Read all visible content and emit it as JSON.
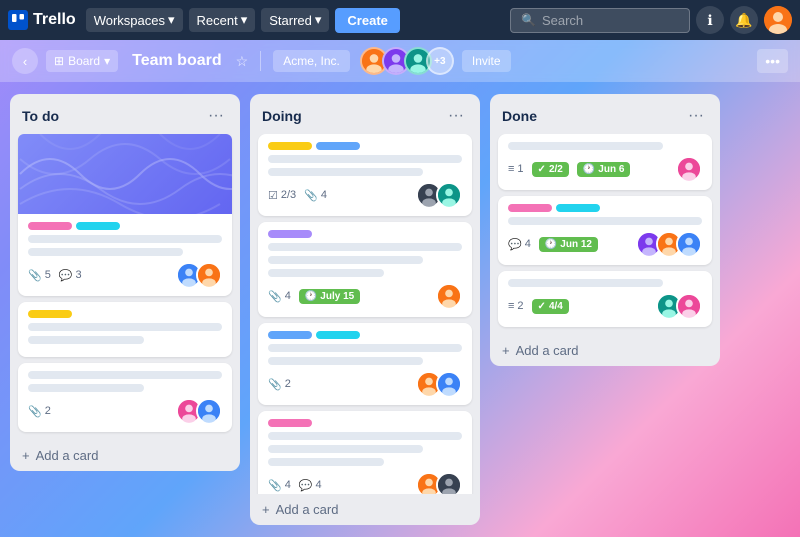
{
  "app": {
    "name": "Trello"
  },
  "topnav": {
    "workspaces_label": "Workspaces",
    "recent_label": "Recent",
    "starred_label": "Starred",
    "create_label": "Create",
    "search_placeholder": "Search",
    "chevron": "▾"
  },
  "board_header": {
    "view_label": "Board",
    "title": "Team board",
    "workspace_label": "Acme, Inc.",
    "more_members_label": "+3",
    "invite_label": "Invite",
    "more_label": "•••"
  },
  "columns": [
    {
      "id": "todo",
      "title": "To do",
      "cards": [
        {
          "id": "c1",
          "has_cover": true,
          "labels": [
            "pink",
            "cyan"
          ],
          "meta": {
            "attachments": "5",
            "comments": "3"
          },
          "avatars": [
            "orange",
            "blue"
          ]
        },
        {
          "id": "c2",
          "labels": [
            "yellow"
          ],
          "lines": [
            "full",
            "medium"
          ],
          "meta": {},
          "avatars": []
        },
        {
          "id": "c3",
          "labels": [],
          "lines": [
            "full",
            "short"
          ],
          "meta": {
            "attachments": "2"
          },
          "avatars": [
            "pink",
            "blue"
          ]
        }
      ],
      "add_card_label": "+ Add a card"
    },
    {
      "id": "doing",
      "title": "Doing",
      "cards": [
        {
          "id": "d1",
          "labels": [
            "yellow",
            "blue"
          ],
          "lines": [
            "full",
            "medium"
          ],
          "meta": {
            "checklist": "2/3",
            "attachments": "4"
          },
          "avatars": [
            "dark",
            "teal"
          ]
        },
        {
          "id": "d2",
          "labels": [
            "purple"
          ],
          "lines": [
            "full",
            "medium",
            "short"
          ],
          "meta": {
            "attachments": "4",
            "date": "July 15"
          },
          "avatars": [
            "orange"
          ]
        },
        {
          "id": "d3",
          "labels": [
            "blue",
            "cyan"
          ],
          "lines": [
            "full",
            "medium"
          ],
          "meta": {
            "attachments": "2"
          },
          "avatars": [
            "orange",
            "blue"
          ]
        },
        {
          "id": "d4",
          "labels": [
            "pink"
          ],
          "lines": [
            "full",
            "medium",
            "short"
          ],
          "meta": {
            "attachments": "4",
            "comments": "4"
          },
          "avatars": [
            "orange",
            "dark"
          ]
        }
      ],
      "add_card_label": "+ Add a card"
    },
    {
      "id": "done",
      "title": "Done",
      "cards": [
        {
          "id": "dn1",
          "labels": [],
          "lines": [
            "medium"
          ],
          "meta": {
            "num": "1",
            "check": "2/2",
            "date": "Jun 6"
          },
          "avatars": [
            "pink"
          ]
        },
        {
          "id": "dn2",
          "labels": [
            "pink",
            "cyan"
          ],
          "lines": [
            "full"
          ],
          "meta": {
            "comments": "4",
            "date": "Jun 12"
          },
          "avatars": [
            "purple",
            "orange",
            "blue"
          ]
        },
        {
          "id": "dn3",
          "labels": [],
          "lines": [
            "medium"
          ],
          "meta": {
            "num": "2",
            "check": "4/4"
          },
          "avatars": [
            "teal",
            "pink"
          ]
        }
      ],
      "add_card_label": "+ Add a card"
    }
  ]
}
